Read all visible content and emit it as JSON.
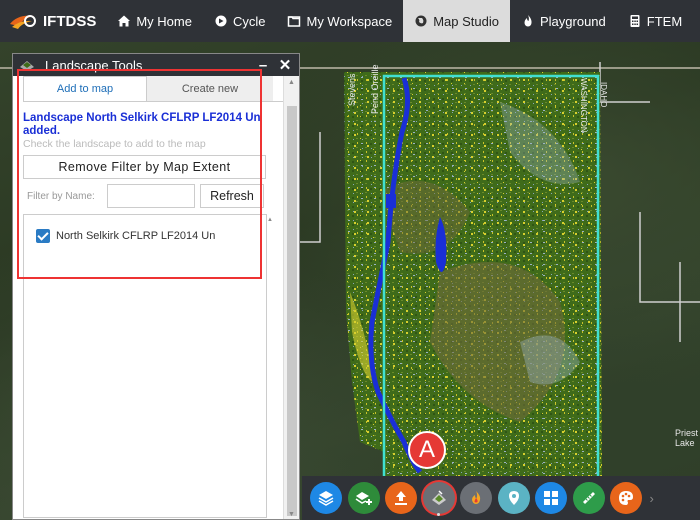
{
  "nav": {
    "brand": "IFTDSS",
    "items": [
      {
        "label": "My Home",
        "icon": "home-icon"
      },
      {
        "label": "Cycle",
        "icon": "cycle-icon"
      },
      {
        "label": "My Workspace",
        "icon": "folder-icon"
      },
      {
        "label": "Map Studio",
        "icon": "globe-icon",
        "active": true
      },
      {
        "label": "Playground",
        "icon": "fire-icon"
      },
      {
        "label": "FTEM",
        "icon": "calculator-icon"
      }
    ]
  },
  "panel": {
    "title": "Landscape Tools",
    "minimize": "–",
    "close": "✕",
    "tabs": [
      "Add to map",
      "Create new"
    ],
    "message": "Landscape North Selkirk CFLRP LF2014 Un added.",
    "hint": "Check the landscape to add to the map",
    "remove_filter_label": "Remove Filter by Map Extent",
    "filter_label": "Filter by Name:",
    "filter_value": "",
    "refresh_label": "Refresh",
    "landscapes": [
      {
        "name": "North Selkirk CFLRP LF2014 Un",
        "checked": true
      }
    ]
  },
  "map": {
    "labels": [
      "Stevens",
      "Pend Oreille",
      "WASHINGTON",
      "IDAHO",
      "Priest Lake"
    ],
    "colors": {
      "forest": "#3f6b1a",
      "water": "#1a2fd6",
      "extent": "#40e0d0"
    }
  },
  "callout": "A",
  "toolbar": {
    "buttons": [
      {
        "name": "layers-button",
        "color": "#1e88e5"
      },
      {
        "name": "add-layer-button",
        "color": "#2e8b3a"
      },
      {
        "name": "upload-button",
        "color": "#e8651a"
      },
      {
        "name": "landscape-tools-button",
        "color": "#6b6f75",
        "selected": true
      },
      {
        "name": "fire-button",
        "color": "#6b6f75"
      },
      {
        "name": "marker-button",
        "color": "#5bb3c4"
      },
      {
        "name": "grid-button",
        "color": "#1e88e5"
      },
      {
        "name": "measure-button",
        "color": "#2e9c4a"
      },
      {
        "name": "style-button",
        "color": "#e8651a"
      }
    ],
    "more": "›"
  }
}
